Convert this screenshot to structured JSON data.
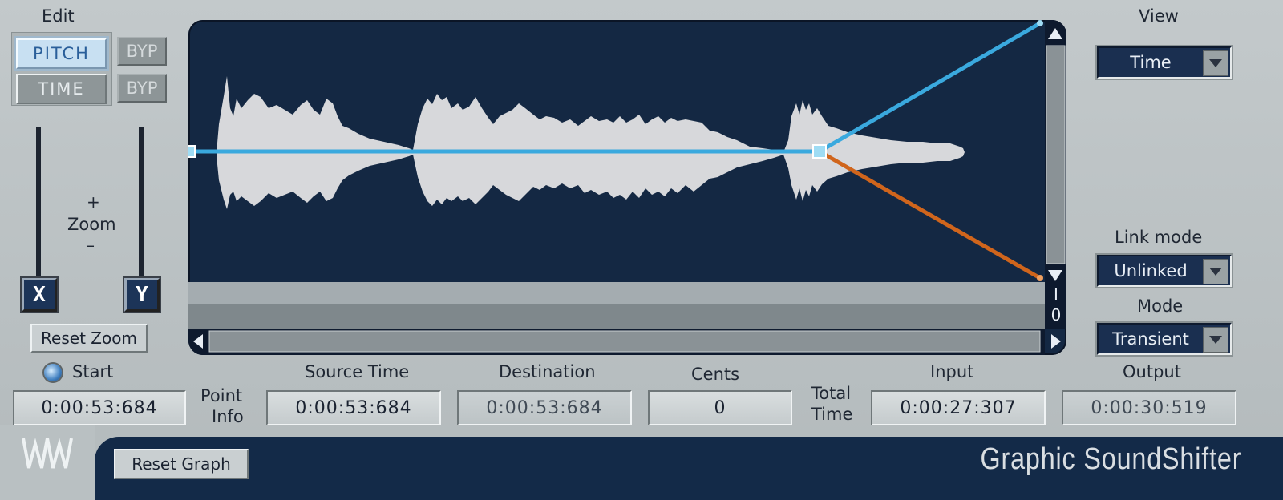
{
  "app": {
    "brand": "Graphic SoundShifter"
  },
  "edit": {
    "title": "Edit",
    "pitch_label": "PITCH",
    "time_label": "TIME",
    "byp_label": "BYP",
    "zoom_label": "Zoom",
    "zoom_plus": "+",
    "zoom_minus": "–",
    "x_label": "X",
    "y_label": "Y",
    "reset_zoom": "Reset Zoom"
  },
  "view": {
    "title": "View",
    "view_value": "Time",
    "link_mode_title": "Link mode",
    "link_mode_value": "Unlinked",
    "mode_title": "Mode",
    "mode_value": "Transient"
  },
  "scale": {
    "top": "I",
    "bottom": "0"
  },
  "info": {
    "start_label": "Start",
    "start_value": "0:00:53:684",
    "point_info_line1": "Point",
    "point_info_line2": "Info",
    "source_time_label": "Source Time",
    "source_time_value": "0:00:53:684",
    "destination_label": "Destination",
    "destination_value": "0:00:53:684",
    "cents_label": "Cents",
    "cents_value": "0",
    "total_time_line1": "Total",
    "total_time_line2": "Time",
    "input_label": "Input",
    "input_value": "0:00:27:307",
    "output_label": "Output",
    "output_value": "0:00:30:519"
  },
  "footer": {
    "reset_graph": "Reset Graph"
  },
  "colors": {
    "display_bg": "#142843",
    "pitch_curve": "#3aa9de",
    "time_curve": "#d0651c",
    "waveform": "#e4e4e6"
  }
}
